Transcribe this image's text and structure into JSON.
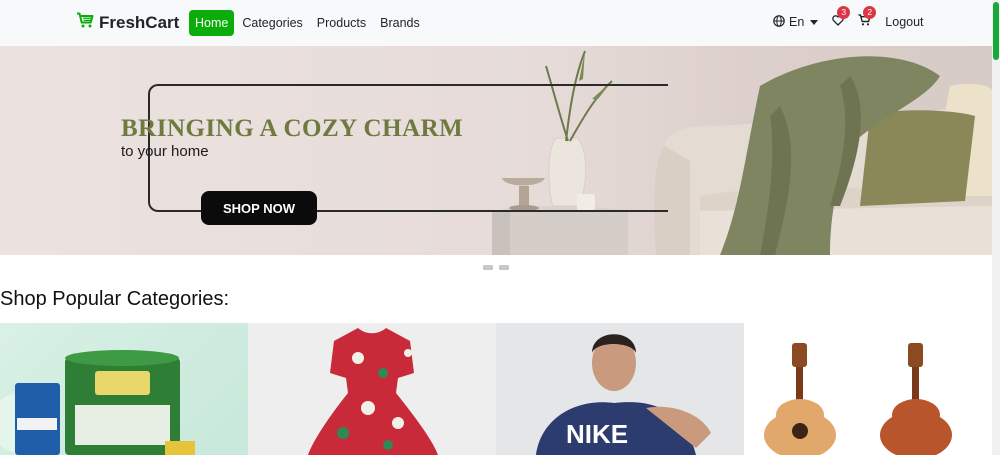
{
  "brand": {
    "name": "FreshCart"
  },
  "nav": {
    "links": [
      {
        "label": "Home"
      },
      {
        "label": "Categories"
      },
      {
        "label": "Products"
      },
      {
        "label": "Brands"
      }
    ]
  },
  "user_menu": {
    "language": "En",
    "wishlist_count": "3",
    "cart_count": "2",
    "logout": "Logout"
  },
  "hero": {
    "title": "BRINGING A COZY CHARM",
    "subtitle": "to your home",
    "cta": "SHOP NOW"
  },
  "categories_section": {
    "title": "Shop Popular Categories:"
  },
  "colors": {
    "brand_green": "#0aad0a",
    "badge_red": "#dc3545",
    "hero_title_olive": "#6e7a3f"
  },
  "icons": [
    "cart-icon",
    "globe-icon",
    "heart-icon",
    "cart-icon"
  ]
}
